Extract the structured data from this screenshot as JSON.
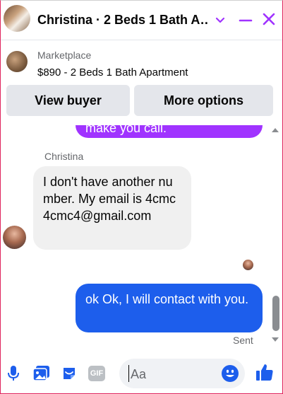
{
  "header": {
    "title": "Christina · 2 Beds 1 Bath A…",
    "accent_color": "#a033ff"
  },
  "listing": {
    "source": "Marketplace",
    "title": "$890 - 2 Beds 1 Bath Apartment",
    "view_buyer_label": "View buyer",
    "more_options_label": "More options"
  },
  "conversation": {
    "previous_message_fragment": "make you call.",
    "incoming": {
      "sender": "Christina",
      "text": "I don't have another number. My email is 4cmc4cmc4@gmail.com"
    },
    "outgoing": {
      "text": "ok Ok, I will contact with you.",
      "status": "Sent",
      "bubble_color": "#1d5eec"
    }
  },
  "composer": {
    "placeholder": "Aa",
    "icons": [
      "microphone-icon",
      "photo-icon",
      "sticker-icon",
      "gif-icon",
      "emoji-icon",
      "thumbs-up-icon"
    ],
    "gif_label": "GIF"
  }
}
